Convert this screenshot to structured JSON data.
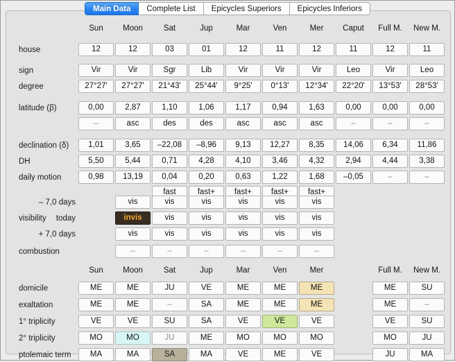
{
  "window": {
    "title": "Main Data"
  },
  "tabs": [
    {
      "label": "Main Data",
      "active": true
    },
    {
      "label": "Complete List",
      "active": false
    },
    {
      "label": "Epicycles Superiors",
      "active": false
    },
    {
      "label": "Epicycles Inferiors",
      "active": false
    }
  ],
  "columns_top": [
    "Sun",
    "Moon",
    "Sat",
    "Jup",
    "Mar",
    "Ven",
    "Mer",
    "Caput",
    "Full M.",
    "New M."
  ],
  "columns_bottom": [
    "Sun",
    "Moon",
    "Sat",
    "Jup",
    "Mar",
    "Ven",
    "Mer",
    "",
    "Full M.",
    "New M."
  ],
  "labels": {
    "house": "house",
    "sign": "sign",
    "degree": "degree",
    "latitude": "latitude (β)",
    "declination": "declination (δ)",
    "dh": "DH",
    "daily_motion": "daily motion",
    "visibility": "visibility",
    "minus_days": "– 7,0 days",
    "today": "today",
    "plus_days": "+ 7,0 days",
    "combustion": "combustion",
    "domicile": "domicile",
    "exaltation": "exaltation",
    "triplicity1": "1° triplicity",
    "triplicity2": "2° triplicity",
    "ptolemaic_term": "ptolemaic term"
  },
  "rows": {
    "house": [
      "12",
      "12",
      "03",
      "01",
      "12",
      "11",
      "12",
      "11",
      "12",
      "11"
    ],
    "sign": [
      "Vir",
      "Vir",
      "Sgr",
      "Lib",
      "Vir",
      "Vir",
      "Vir",
      "Leo",
      "Vir",
      "Leo"
    ],
    "degree": [
      "27°27'",
      "27°27'",
      "21°43'",
      "25°44'",
      "9°25'",
      "0°13'",
      "12°34'",
      "22°20'",
      "13°53'",
      "28°53'"
    ],
    "latitude": [
      "0,00",
      "2,87",
      "1,10",
      "1,06",
      "1,17",
      "0,94",
      "1,63",
      "0,00",
      "0,00",
      "0,00"
    ],
    "latitude_dir": [
      "–",
      "asc",
      "des",
      "des",
      "asc",
      "asc",
      "asc",
      "–",
      "–",
      "–"
    ],
    "declination": [
      "1,01",
      "3,65",
      "–22,08",
      "–8,96",
      "9,13",
      "12,27",
      "8,35",
      "14,06",
      "6,34",
      "11,86"
    ],
    "dh": [
      "5,50",
      "5,44",
      "0,71",
      "4,28",
      "4,10",
      "3,46",
      "4,32",
      "2,94",
      "4,44",
      "3,38"
    ],
    "daily_motion": [
      "0,98",
      "13,19",
      "0,04",
      "0,20",
      "0,63",
      "1,22",
      "1,68",
      "–0,05",
      "–",
      "–"
    ],
    "speed": [
      "fast",
      "fast+",
      "fast+",
      "fast+",
      "fast+"
    ],
    "vis_minus": [
      "vis",
      "vis",
      "vis",
      "vis",
      "vis",
      "vis"
    ],
    "vis_today": [
      "invis",
      "vis",
      "vis",
      "vis",
      "vis",
      "vis"
    ],
    "vis_plus": [
      "vis",
      "vis",
      "vis",
      "vis",
      "vis",
      "vis"
    ],
    "combustion": [
      "–",
      "–",
      "–",
      "–",
      "–",
      "–"
    ],
    "domicile": [
      "ME",
      "ME",
      "JU",
      "VE",
      "ME",
      "ME",
      "ME",
      "",
      "ME",
      "SU"
    ],
    "exaltation": [
      "ME",
      "ME",
      "–",
      "SA",
      "ME",
      "ME",
      "ME",
      "",
      "ME",
      "–"
    ],
    "triplicity1": [
      "VE",
      "VE",
      "SU",
      "SA",
      "VE",
      "VE",
      "VE",
      "",
      "VE",
      "SU"
    ],
    "triplicity2": [
      "MO",
      "MO",
      "JU",
      "ME",
      "MO",
      "MO",
      "MO",
      "",
      "MO",
      "JU"
    ],
    "ptolemaic_term": [
      "MA",
      "MA",
      "SA",
      "MA",
      "VE",
      "ME",
      "VE",
      "",
      "JU",
      "MA"
    ]
  },
  "dim_cells": {
    "latitude_dir": [
      0,
      7,
      8,
      9
    ],
    "daily_motion": [
      8,
      9
    ],
    "combustion": [
      0,
      1,
      2,
      3,
      4,
      5
    ],
    "exaltation": [
      2,
      9
    ],
    "triplicity2": [
      2
    ]
  },
  "highlights": {
    "vis_today": {
      "0": "hl-dark"
    },
    "domicile": {
      "6": "hl-cream"
    },
    "exaltation": {
      "6": "hl-cream"
    },
    "triplicity1": {
      "5": "hl-green"
    },
    "triplicity2": {
      "1": "hl-cyan"
    },
    "ptolemaic_term": {
      "2": "hl-gray"
    }
  },
  "colors": {
    "accent": "#2f86ef",
    "highlight_cream": "#f4e3b5",
    "highlight_green": "#cde79b",
    "highlight_cyan": "#d9f6f6",
    "highlight_gray": "#b8b09a",
    "invis_bg": "#382d20",
    "invis_text": "#f2a92e"
  }
}
